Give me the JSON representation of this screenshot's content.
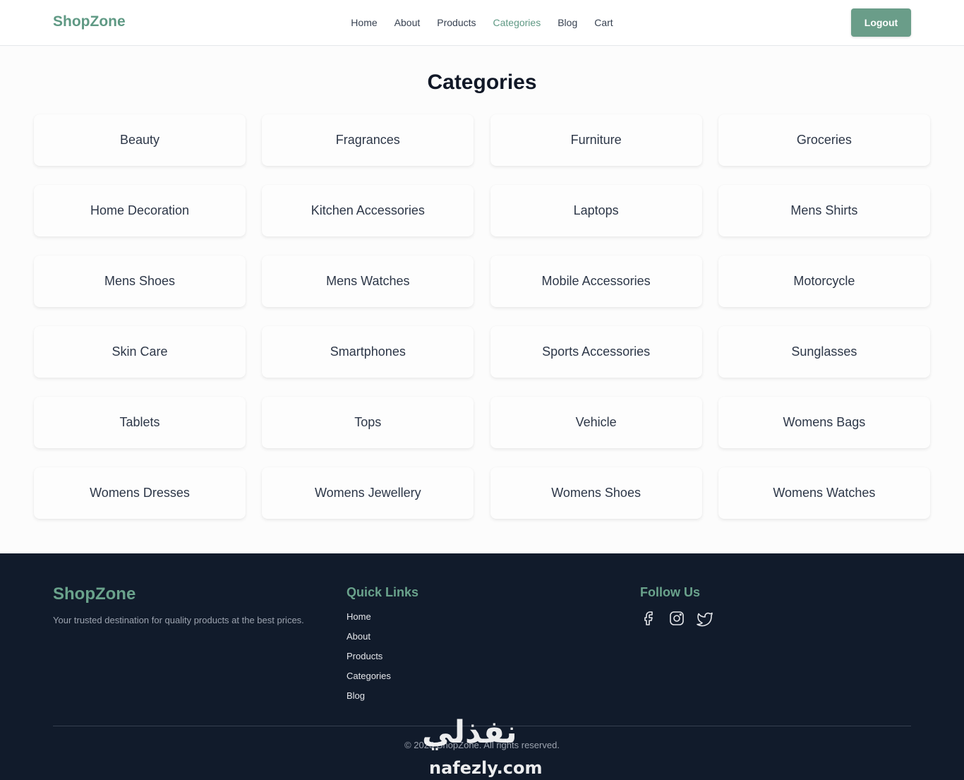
{
  "header": {
    "logo": "ShopZone",
    "nav": [
      "Home",
      "About",
      "Products",
      "Categories",
      "Blog",
      "Cart"
    ],
    "active_nav": "Categories",
    "logout_label": "Logout"
  },
  "main": {
    "title": "Categories",
    "categories": [
      "Beauty",
      "Fragrances",
      "Furniture",
      "Groceries",
      "Home Decoration",
      "Kitchen Accessories",
      "Laptops",
      "Mens Shirts",
      "Mens Shoes",
      "Mens Watches",
      "Mobile Accessories",
      "Motorcycle",
      "Skin Care",
      "Smartphones",
      "Sports Accessories",
      "Sunglasses",
      "Tablets",
      "Tops",
      "Vehicle",
      "Womens Bags",
      "Womens Dresses",
      "Womens Jewellery",
      "Womens Shoes",
      "Womens Watches"
    ]
  },
  "footer": {
    "brand": "ShopZone",
    "tagline": "Your trusted destination for quality products at the best prices.",
    "quick_links_heading": "Quick Links",
    "quick_links": [
      "Home",
      "About",
      "Products",
      "Categories",
      "Blog"
    ],
    "follow_heading": "Follow Us",
    "socials": [
      "facebook-icon",
      "instagram-icon",
      "twitter-icon"
    ],
    "copyright": "© 2025 ShopZone. All rights reserved."
  },
  "watermark": {
    "arabic": "نفذلي",
    "latin": "nafezly.com"
  },
  "colors": {
    "accent": "#5f9984",
    "button": "#6a9d89",
    "footer_bg": "#111b2b"
  }
}
